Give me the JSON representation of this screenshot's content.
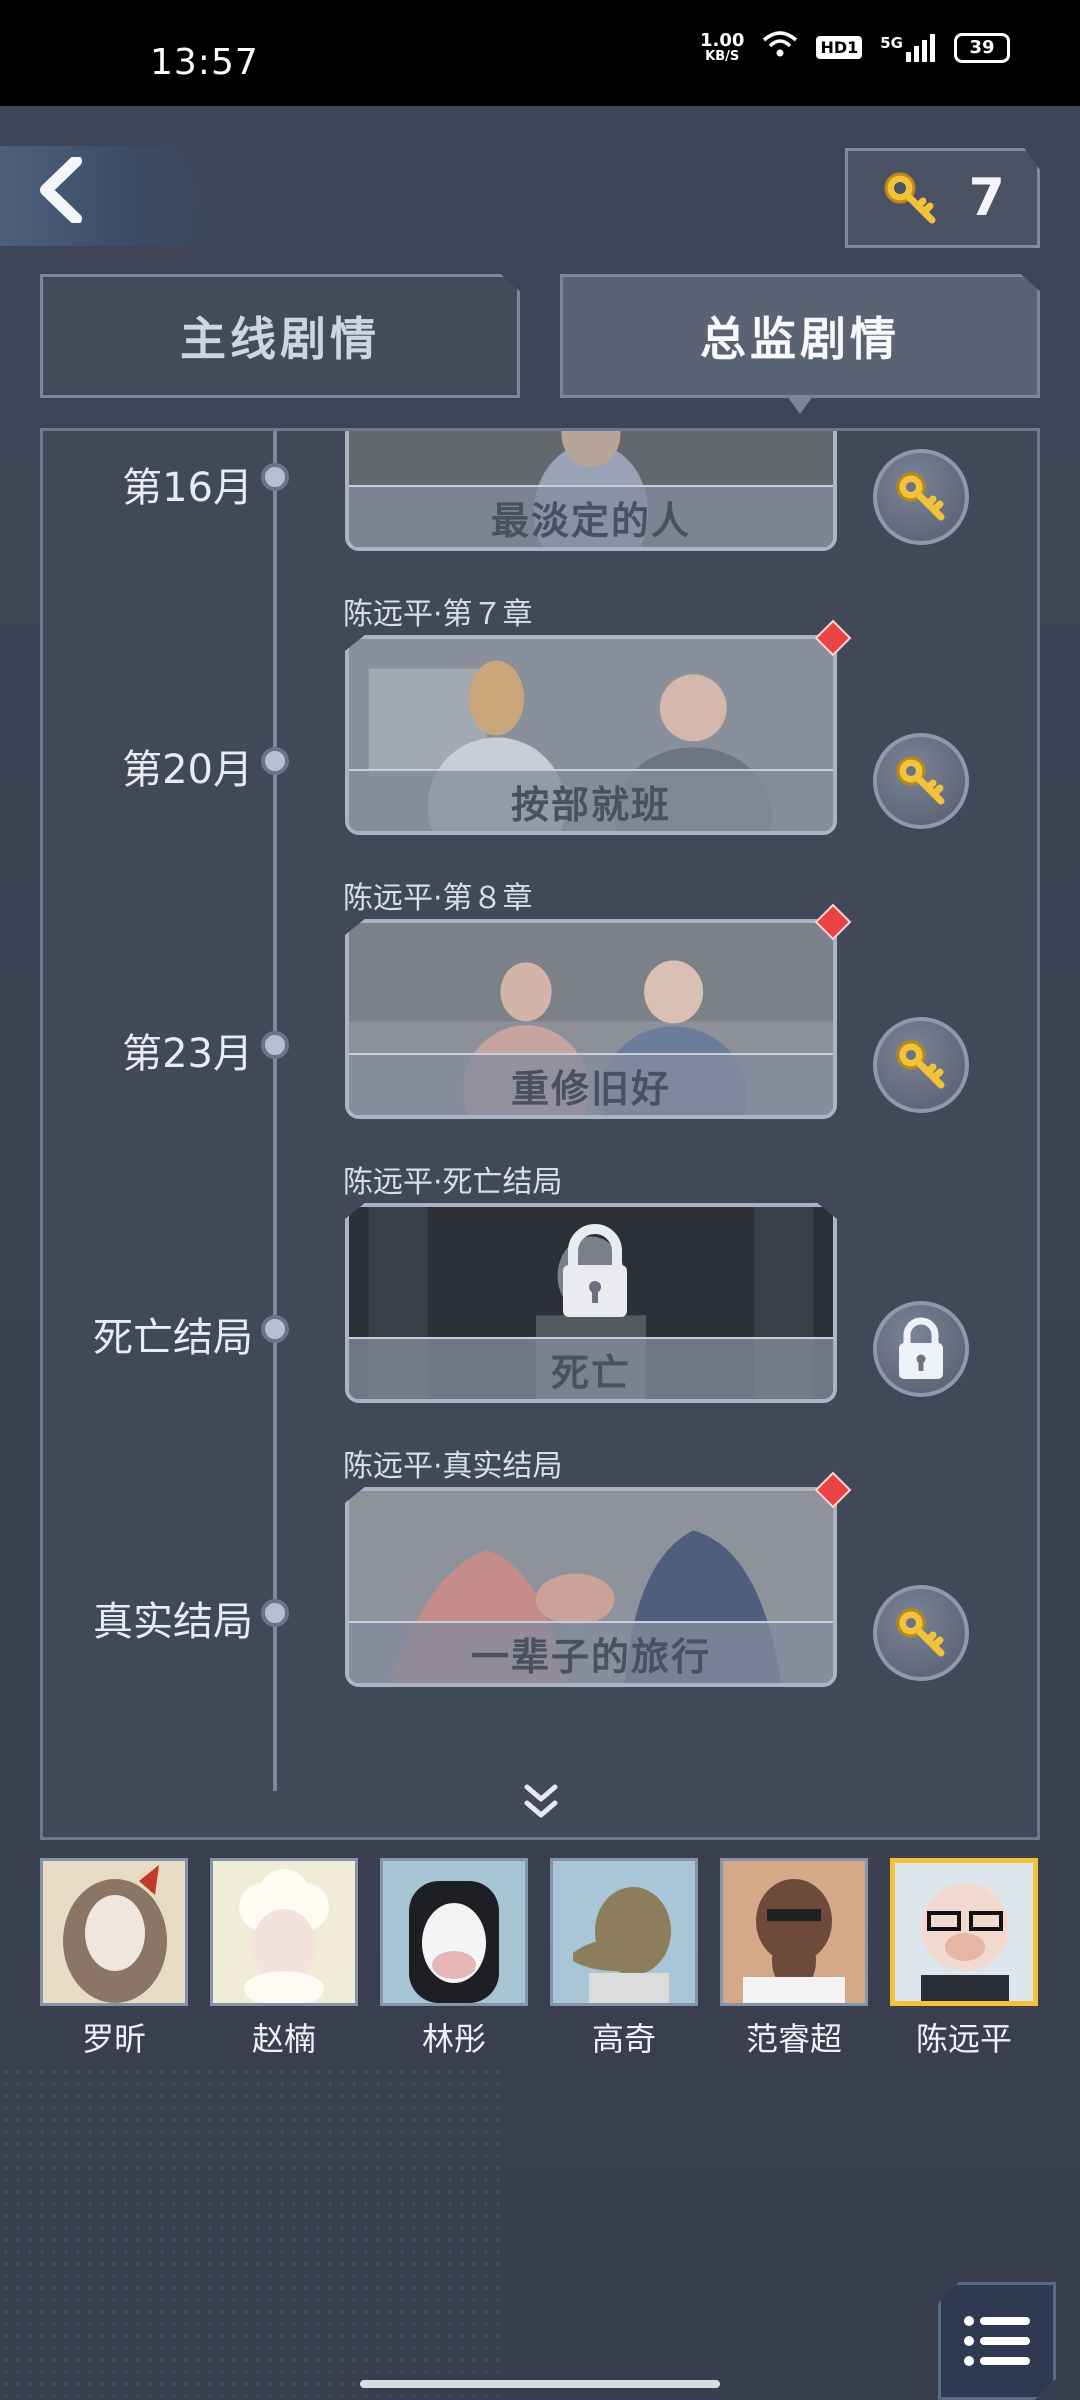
{
  "status": {
    "time": "13:57",
    "net_speed_value": "1.00",
    "net_speed_unit": "KB/S",
    "hd_badge": "HD1",
    "signal_label": "5G",
    "battery": "39"
  },
  "header": {
    "keys_count": "7"
  },
  "tabs": {
    "main_label": "主线剧情",
    "supervisor_label": "总监剧情",
    "active": "supervisor"
  },
  "timeline": {
    "rows": [
      {
        "month": "第16月",
        "chapter": "",
        "title": "最淡定的人",
        "state": "key",
        "new": false
      },
      {
        "month": "第20月",
        "chapter": "陈远平·第７章",
        "title": "按部就班",
        "state": "key",
        "new": true
      },
      {
        "month": "第23月",
        "chapter": "陈远平·第８章",
        "title": "重修旧好",
        "state": "key",
        "new": true
      },
      {
        "month": "死亡结局",
        "chapter": "陈远平·死亡结局",
        "title": "死亡",
        "state": "locked",
        "new": false
      },
      {
        "month": "真实结局",
        "chapter": "陈远平·真实结局",
        "title": "一辈子的旅行",
        "state": "key",
        "new": true
      }
    ]
  },
  "characters": [
    {
      "name": "罗昕",
      "selected": false
    },
    {
      "name": "赵楠",
      "selected": false
    },
    {
      "name": "林彤",
      "selected": false
    },
    {
      "name": "高奇",
      "selected": false
    },
    {
      "name": "范睿超",
      "selected": false
    },
    {
      "name": "陈远平",
      "selected": true
    }
  ],
  "colors": {
    "accent_gold": "#f2c23a",
    "new_marker": "#e94343",
    "panel_bg": "#414858"
  }
}
